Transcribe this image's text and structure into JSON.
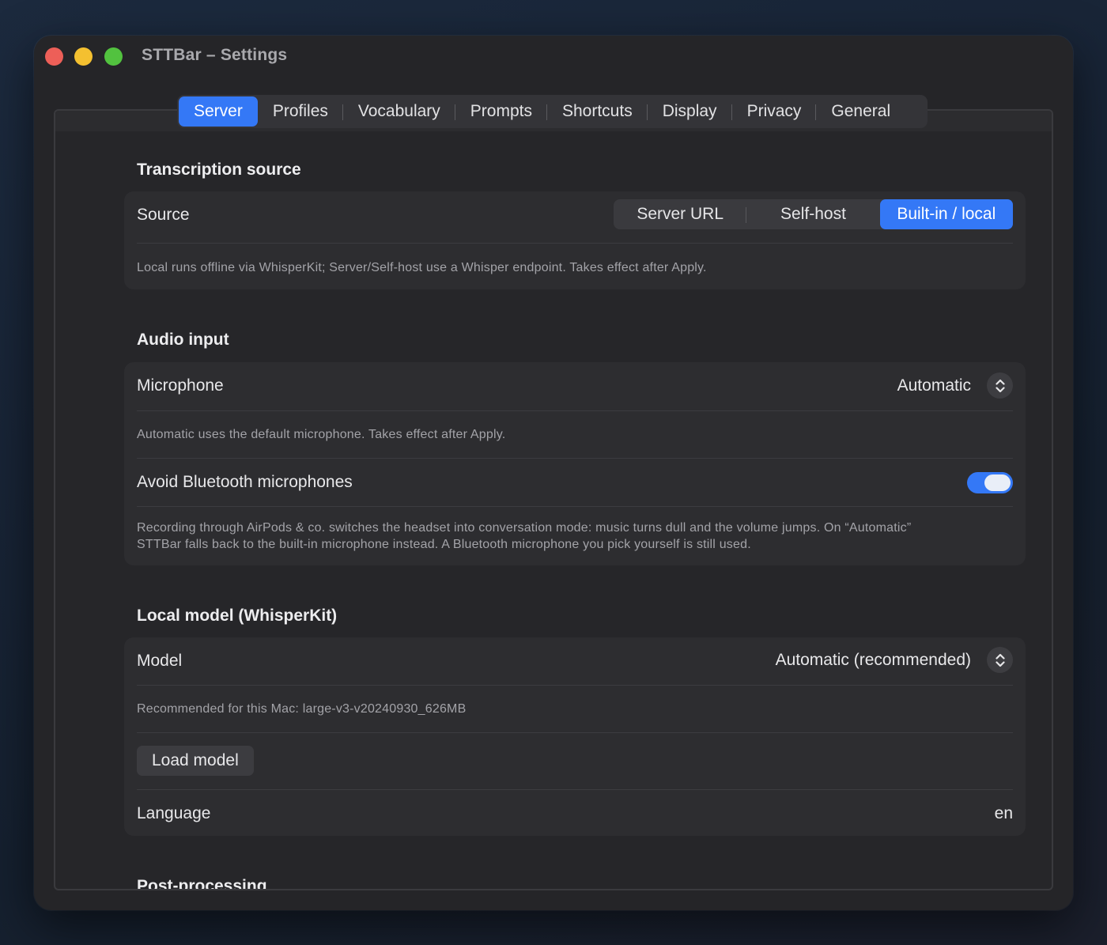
{
  "window": {
    "title": "STTBar – Settings"
  },
  "tabs": [
    {
      "label": "Server",
      "active": true
    },
    {
      "label": "Profiles"
    },
    {
      "label": "Vocabulary"
    },
    {
      "label": "Prompts"
    },
    {
      "label": "Shortcuts"
    },
    {
      "label": "Display"
    },
    {
      "label": "Privacy"
    },
    {
      "label": "General"
    }
  ],
  "transcription": {
    "title": "Transcription source",
    "source_label": "Source",
    "options": [
      "Server URL",
      "Self-host",
      "Built-in / local"
    ],
    "selected": "Built-in / local",
    "help": "Local runs offline via WhisperKit; Server/Self-host use a Whisper endpoint. Takes effect after Apply."
  },
  "audio": {
    "title": "Audio input",
    "microphone_label": "Microphone",
    "microphone_value": "Automatic",
    "microphone_help": "Automatic uses the default microphone. Takes effect after Apply.",
    "bluetooth_label": "Avoid Bluetooth microphones",
    "bluetooth_enabled": true,
    "bluetooth_help_1": "Recording through AirPods & co. switches the headset into conversation mode: music turns dull and the volume jumps. On “Automatic”",
    "bluetooth_help_2": "STTBar falls back to the built-in microphone instead. A Bluetooth microphone you pick yourself is still used."
  },
  "local_model": {
    "title": "Local model (WhisperKit)",
    "model_label": "Model",
    "model_value": "Automatic (recommended)",
    "recommendation": "Recommended for this Mac: large-v3-v20240930_626MB",
    "load_button": "Load model",
    "language_label": "Language",
    "language_value": "en"
  },
  "post_processing": {
    "title": "Post-processing"
  },
  "colors": {
    "accent": "#3478f6",
    "window_bg": "#252528",
    "card_bg": "#2d2d30"
  },
  "icons": {
    "popup": "chevron-up-down-icon"
  }
}
